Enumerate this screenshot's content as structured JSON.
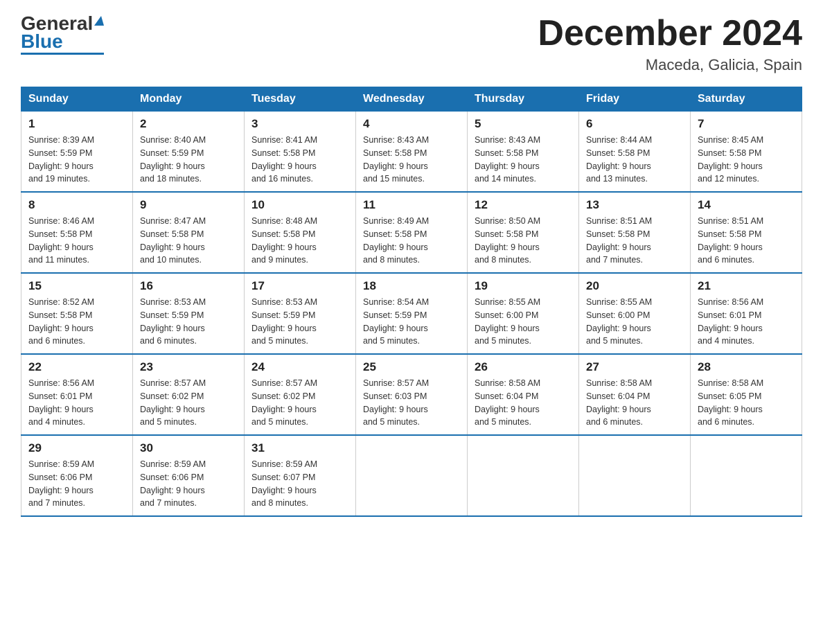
{
  "header": {
    "logo_text_black": "General",
    "logo_text_blue": "Blue",
    "month_title": "December 2024",
    "location": "Maceda, Galicia, Spain"
  },
  "weekdays": [
    "Sunday",
    "Monday",
    "Tuesday",
    "Wednesday",
    "Thursday",
    "Friday",
    "Saturday"
  ],
  "weeks": [
    [
      {
        "day": "1",
        "sunrise": "8:39 AM",
        "sunset": "5:59 PM",
        "daylight": "9 hours and 19 minutes."
      },
      {
        "day": "2",
        "sunrise": "8:40 AM",
        "sunset": "5:59 PM",
        "daylight": "9 hours and 18 minutes."
      },
      {
        "day": "3",
        "sunrise": "8:41 AM",
        "sunset": "5:58 PM",
        "daylight": "9 hours and 16 minutes."
      },
      {
        "day": "4",
        "sunrise": "8:43 AM",
        "sunset": "5:58 PM",
        "daylight": "9 hours and 15 minutes."
      },
      {
        "day": "5",
        "sunrise": "8:43 AM",
        "sunset": "5:58 PM",
        "daylight": "9 hours and 14 minutes."
      },
      {
        "day": "6",
        "sunrise": "8:44 AM",
        "sunset": "5:58 PM",
        "daylight": "9 hours and 13 minutes."
      },
      {
        "day": "7",
        "sunrise": "8:45 AM",
        "sunset": "5:58 PM",
        "daylight": "9 hours and 12 minutes."
      }
    ],
    [
      {
        "day": "8",
        "sunrise": "8:46 AM",
        "sunset": "5:58 PM",
        "daylight": "9 hours and 11 minutes."
      },
      {
        "day": "9",
        "sunrise": "8:47 AM",
        "sunset": "5:58 PM",
        "daylight": "9 hours and 10 minutes."
      },
      {
        "day": "10",
        "sunrise": "8:48 AM",
        "sunset": "5:58 PM",
        "daylight": "9 hours and 9 minutes."
      },
      {
        "day": "11",
        "sunrise": "8:49 AM",
        "sunset": "5:58 PM",
        "daylight": "9 hours and 8 minutes."
      },
      {
        "day": "12",
        "sunrise": "8:50 AM",
        "sunset": "5:58 PM",
        "daylight": "9 hours and 8 minutes."
      },
      {
        "day": "13",
        "sunrise": "8:51 AM",
        "sunset": "5:58 PM",
        "daylight": "9 hours and 7 minutes."
      },
      {
        "day": "14",
        "sunrise": "8:51 AM",
        "sunset": "5:58 PM",
        "daylight": "9 hours and 6 minutes."
      }
    ],
    [
      {
        "day": "15",
        "sunrise": "8:52 AM",
        "sunset": "5:58 PM",
        "daylight": "9 hours and 6 minutes."
      },
      {
        "day": "16",
        "sunrise": "8:53 AM",
        "sunset": "5:59 PM",
        "daylight": "9 hours and 6 minutes."
      },
      {
        "day": "17",
        "sunrise": "8:53 AM",
        "sunset": "5:59 PM",
        "daylight": "9 hours and 5 minutes."
      },
      {
        "day": "18",
        "sunrise": "8:54 AM",
        "sunset": "5:59 PM",
        "daylight": "9 hours and 5 minutes."
      },
      {
        "day": "19",
        "sunrise": "8:55 AM",
        "sunset": "6:00 PM",
        "daylight": "9 hours and 5 minutes."
      },
      {
        "day": "20",
        "sunrise": "8:55 AM",
        "sunset": "6:00 PM",
        "daylight": "9 hours and 5 minutes."
      },
      {
        "day": "21",
        "sunrise": "8:56 AM",
        "sunset": "6:01 PM",
        "daylight": "9 hours and 4 minutes."
      }
    ],
    [
      {
        "day": "22",
        "sunrise": "8:56 AM",
        "sunset": "6:01 PM",
        "daylight": "9 hours and 4 minutes."
      },
      {
        "day": "23",
        "sunrise": "8:57 AM",
        "sunset": "6:02 PM",
        "daylight": "9 hours and 5 minutes."
      },
      {
        "day": "24",
        "sunrise": "8:57 AM",
        "sunset": "6:02 PM",
        "daylight": "9 hours and 5 minutes."
      },
      {
        "day": "25",
        "sunrise": "8:57 AM",
        "sunset": "6:03 PM",
        "daylight": "9 hours and 5 minutes."
      },
      {
        "day": "26",
        "sunrise": "8:58 AM",
        "sunset": "6:04 PM",
        "daylight": "9 hours and 5 minutes."
      },
      {
        "day": "27",
        "sunrise": "8:58 AM",
        "sunset": "6:04 PM",
        "daylight": "9 hours and 6 minutes."
      },
      {
        "day": "28",
        "sunrise": "8:58 AM",
        "sunset": "6:05 PM",
        "daylight": "9 hours and 6 minutes."
      }
    ],
    [
      {
        "day": "29",
        "sunrise": "8:59 AM",
        "sunset": "6:06 PM",
        "daylight": "9 hours and 7 minutes."
      },
      {
        "day": "30",
        "sunrise": "8:59 AM",
        "sunset": "6:06 PM",
        "daylight": "9 hours and 7 minutes."
      },
      {
        "day": "31",
        "sunrise": "8:59 AM",
        "sunset": "6:07 PM",
        "daylight": "9 hours and 8 minutes."
      },
      null,
      null,
      null,
      null
    ]
  ],
  "labels": {
    "sunrise": "Sunrise:",
    "sunset": "Sunset:",
    "daylight": "Daylight:"
  }
}
